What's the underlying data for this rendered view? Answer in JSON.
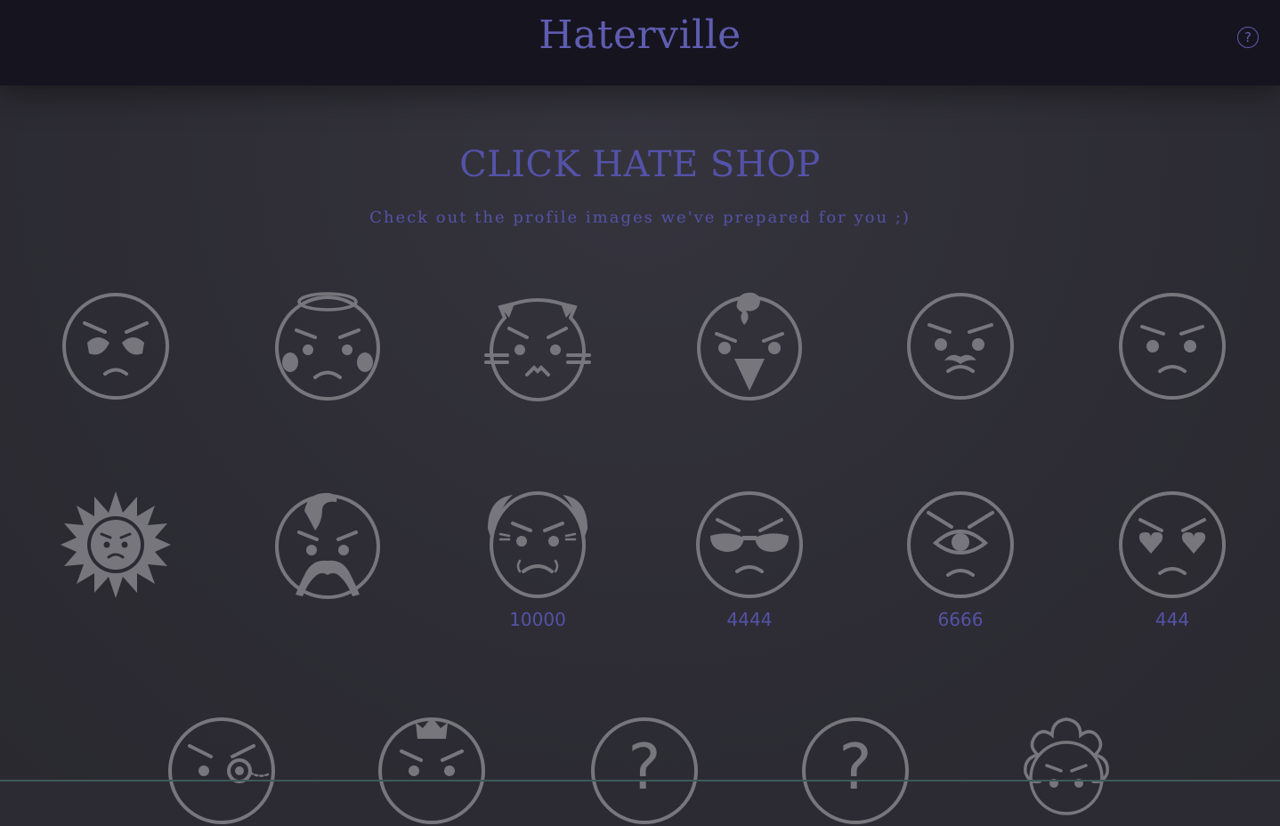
{
  "app": {
    "title": "Haterville",
    "help_icon": "question-circle-icon",
    "help_label": "?"
  },
  "shop": {
    "title": "CLICK HATE SHOP",
    "subtitle": "Check out the profile images we've prepared for you ;)"
  },
  "colors": {
    "header_bg": "#16141f",
    "page_bg": "#2c2b33",
    "accent": "#5452a8",
    "icon_gray": "#77767d"
  },
  "avatars": [
    {
      "icon": "alien-face-icon",
      "price": ""
    },
    {
      "icon": "angel-face-icon",
      "price": ""
    },
    {
      "icon": "cat-face-icon",
      "price": ""
    },
    {
      "icon": "chick-face-icon",
      "price": ""
    },
    {
      "icon": "mustache-face-icon",
      "price": ""
    },
    {
      "icon": "angry-face-icon",
      "price": ""
    },
    {
      "icon": "sun-face-icon",
      "price": ""
    },
    {
      "icon": "pompadour-mustache-face-icon",
      "price": ""
    },
    {
      "icon": "old-man-face-icon",
      "price": "10000"
    },
    {
      "icon": "sunglasses-face-icon",
      "price": "4444"
    },
    {
      "icon": "cyclops-face-icon",
      "price": "6666"
    },
    {
      "icon": "heart-eyes-face-icon",
      "price": "444"
    },
    {
      "icon": "monocle-face-icon",
      "price": ""
    },
    {
      "icon": "crown-face-icon",
      "price": ""
    },
    {
      "icon": "mystery-face-icon",
      "price": ""
    },
    {
      "icon": "mystery-face-icon",
      "price": ""
    },
    {
      "icon": "flower-face-icon",
      "price": ""
    }
  ]
}
